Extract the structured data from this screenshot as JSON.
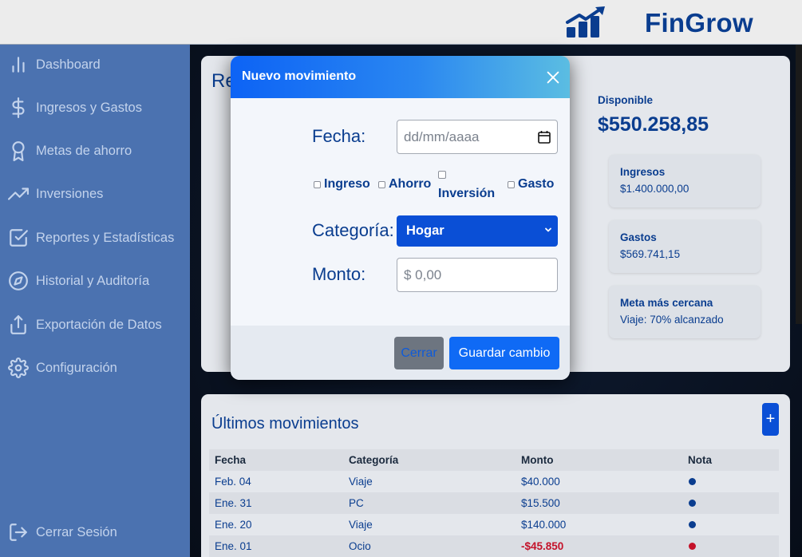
{
  "brand": {
    "name": "FinGrow"
  },
  "sidebar": {
    "items": [
      {
        "label": "Dashboard",
        "icon": "bar-chart-icon"
      },
      {
        "label": "Ingresos y Gastos",
        "icon": "dollar-icon"
      },
      {
        "label": "Metas de ahorro",
        "icon": "award-icon"
      },
      {
        "label": "Inversiones",
        "icon": "trending-up-icon"
      },
      {
        "label": "Reportes y Estadísticas",
        "icon": "check-square-icon"
      },
      {
        "label": "Historial y Auditoría",
        "icon": "compass-icon"
      },
      {
        "label": "Exportación de Datos",
        "icon": "upload-icon"
      },
      {
        "label": "Configuración",
        "icon": "gear-icon"
      }
    ],
    "logout": {
      "label": "Cerrar Sesión",
      "icon": "logout-icon"
    }
  },
  "summary": {
    "title_partial": "Re",
    "available_label": "Disponible",
    "available_value": "$550.258,85",
    "cards": [
      {
        "label": "Ingresos",
        "value": "$1.400.000,00"
      },
      {
        "label": "Gastos",
        "value": "$569.741,15"
      },
      {
        "label": "Meta más cercana",
        "value": "Viaje: 70% alcanzado"
      }
    ]
  },
  "movements": {
    "title": "Últimos movimientos",
    "add_label": "+",
    "headers": [
      "Fecha",
      "Categoría",
      "Monto",
      "Nota"
    ],
    "rows": [
      {
        "fecha": "Feb. 04",
        "categoria": "Viaje",
        "monto": "$40.000",
        "status": "positive"
      },
      {
        "fecha": "Ene. 31",
        "categoria": "PC",
        "monto": "$15.500",
        "status": "positive"
      },
      {
        "fecha": "Ene. 20",
        "categoria": "Viaje",
        "monto": "$140.000",
        "status": "positive"
      },
      {
        "fecha": "Ene. 01",
        "categoria": "Ocio",
        "monto": "-$45.850",
        "status": "negative"
      }
    ]
  },
  "modal": {
    "title": "Nuevo movimiento",
    "fecha_label": "Fecha:",
    "fecha_placeholder": "dd/mm/aaaa",
    "types": [
      "Ingreso",
      "Ahorro",
      "Inversión",
      "Gasto"
    ],
    "categoria_label": "Categoría:",
    "categoria_value": "Hogar",
    "monto_label": "Monto:",
    "monto_placeholder": "$ 0,00",
    "close_button": "Cerrar",
    "save_button": "Guardar cambio"
  },
  "colors": {
    "brand": "#0a3d8f",
    "accent": "#0f6af5",
    "sidebar": "#4b72b0",
    "positive_dot": "#0a3d8f",
    "negative_dot": "#c4122a"
  }
}
